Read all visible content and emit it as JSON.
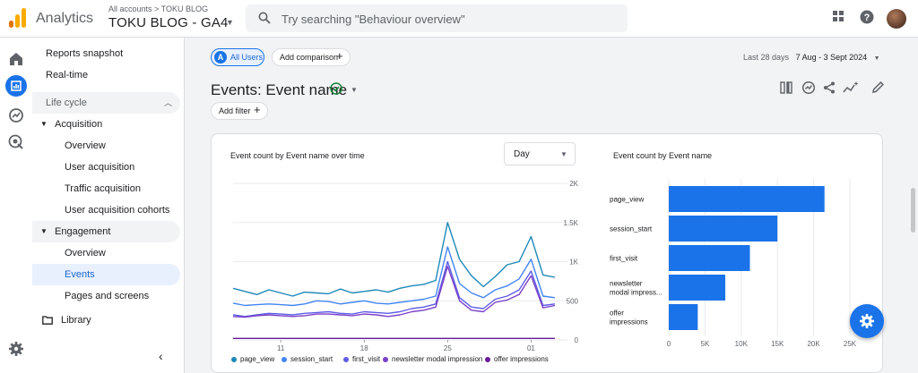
{
  "app": {
    "name": "Analytics",
    "account_path": "All accounts > TOKU BLOG",
    "property": "TOKU BLOG - GA4"
  },
  "search": {
    "placeholder": "Try searching \"Behaviour overview\""
  },
  "rail_icons": [
    "home-icon",
    "reports-icon",
    "explore-icon",
    "advertising-icon",
    "admin-gear-icon"
  ],
  "sidenav": {
    "reports_snapshot": "Reports snapshot",
    "realtime": "Real-time",
    "lifecycle": "Life cycle",
    "acquisition": "Acquisition",
    "acq_items": [
      "Overview",
      "User acquisition",
      "Traffic acquisition",
      "User acquisition cohorts"
    ],
    "engagement": "Engagement",
    "eng_items": [
      "Overview",
      "Events",
      "Pages and screens"
    ],
    "library": "Library"
  },
  "comparison": {
    "segment_badge": "A",
    "segment": "All Users",
    "add_comparison": "Add comparison"
  },
  "date": {
    "label": "Last 28 days",
    "range": "7 Aug - 3 Sept 2024"
  },
  "page": {
    "title": "Events: Event name",
    "add_filter": "Add filter"
  },
  "line_chart_title": "Event count by Event name over time",
  "bar_chart_title": "Event count by Event name",
  "granularity": "Day",
  "colors": {
    "accent": "#1a73e8",
    "page_view": "#1e88b8",
    "session_start": "#4285f4",
    "first_visit": "#5e5ce6",
    "newsletter": "#7b3fc8",
    "offer": "#6a1b9a"
  },
  "chart_data": [
    {
      "type": "line",
      "title": "Event count by Event name over time",
      "x": [
        "7 Aug",
        "8 Aug",
        "9 Aug",
        "10 Aug",
        "11 Aug",
        "12 Aug",
        "13 Aug",
        "14 Aug",
        "15 Aug",
        "16 Aug",
        "17 Aug",
        "18 Aug",
        "19 Aug",
        "20 Aug",
        "21 Aug",
        "22 Aug",
        "23 Aug",
        "24 Aug",
        "25 Aug",
        "26 Aug",
        "27 Aug",
        "28 Aug",
        "29 Aug",
        "30 Aug",
        "31 Aug",
        "1 Sept",
        "2 Sept",
        "3 Sept"
      ],
      "xticks": [
        {
          "index": 4,
          "line1": "11",
          "line2": "Aug"
        },
        {
          "index": 11,
          "line1": "18",
          "line2": ""
        },
        {
          "index": 18,
          "line1": "25",
          "line2": ""
        },
        {
          "index": 25,
          "line1": "01",
          "line2": "Sept"
        }
      ],
      "ylim": [
        0,
        2000
      ],
      "yticks": [
        "0",
        "500",
        "1K",
        "1.5K",
        "2K"
      ],
      "series": [
        {
          "name": "page_view",
          "values": [
            660,
            620,
            580,
            640,
            600,
            560,
            610,
            600,
            590,
            650,
            600,
            620,
            640,
            610,
            660,
            690,
            710,
            760,
            1500,
            1030,
            820,
            680,
            810,
            960,
            1000,
            1320,
            830,
            800
          ]
        },
        {
          "name": "session_start",
          "values": [
            470,
            440,
            450,
            460,
            450,
            440,
            460,
            500,
            490,
            460,
            480,
            500,
            470,
            460,
            480,
            500,
            520,
            560,
            1190,
            720,
            600,
            540,
            640,
            690,
            780,
            1030,
            560,
            540
          ]
        },
        {
          "name": "first_visit",
          "values": [
            320,
            300,
            320,
            340,
            330,
            320,
            340,
            350,
            360,
            340,
            330,
            360,
            350,
            340,
            360,
            400,
            420,
            460,
            1000,
            540,
            420,
            400,
            520,
            560,
            640,
            880,
            440,
            460
          ]
        },
        {
          "name": "newsletter modal impression",
          "values": [
            300,
            290,
            310,
            320,
            310,
            300,
            310,
            330,
            330,
            320,
            310,
            330,
            320,
            300,
            320,
            360,
            380,
            420,
            940,
            500,
            380,
            360,
            480,
            510,
            580,
            820,
            410,
            440
          ]
        },
        {
          "name": "offer impressions",
          "values": [
            20,
            20,
            20,
            20,
            20,
            20,
            20,
            20,
            20,
            20,
            20,
            20,
            20,
            20,
            20,
            20,
            20,
            20,
            20,
            20,
            20,
            20,
            20,
            20,
            20,
            20,
            20,
            20
          ]
        }
      ]
    },
    {
      "type": "bar",
      "orientation": "horizontal",
      "title": "Event count by Event name",
      "categories": [
        [
          "page_view"
        ],
        [
          "session_start"
        ],
        [
          "first_visit"
        ],
        [
          "newsletter",
          "modal impress..."
        ],
        [
          "offer",
          "impressions"
        ]
      ],
      "values": [
        21500,
        15000,
        11200,
        7800,
        4000
      ],
      "xlim": [
        0,
        25000
      ],
      "xticks": [
        "0",
        "5K",
        "10K",
        "15K",
        "20K",
        "25K"
      ]
    }
  ]
}
